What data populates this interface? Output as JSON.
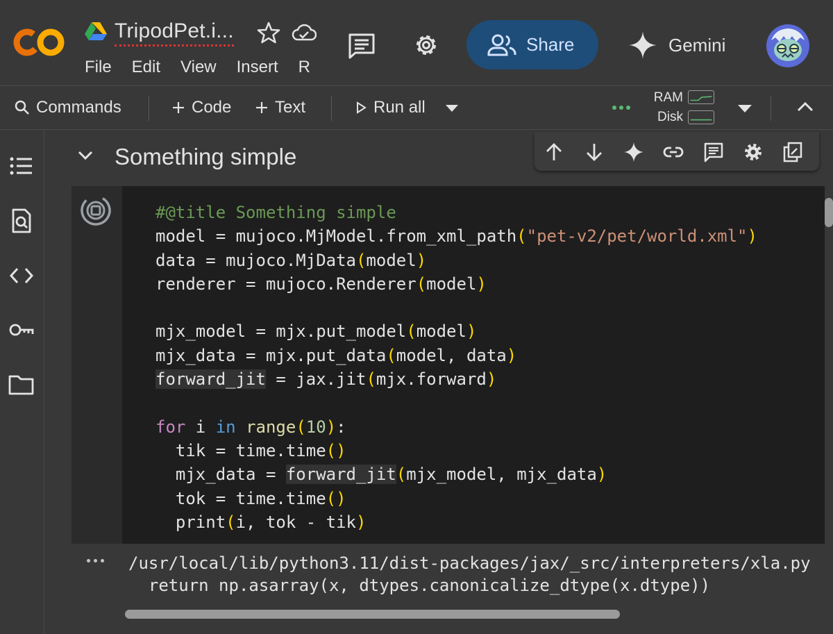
{
  "header": {
    "logo_text": "CO",
    "doc_title": "TripodPet.i...",
    "menu": [
      "File",
      "Edit",
      "View",
      "Insert",
      "R"
    ],
    "share_label": "Share",
    "gemini_label": "Gemini"
  },
  "toolbar": {
    "commands_label": "Commands",
    "code_label": "Code",
    "text_label": "Text",
    "run_all_label": "Run all",
    "ram_label": "RAM",
    "disk_label": "Disk"
  },
  "sidebar": {
    "icons": [
      "table-of-contents-icon",
      "find-replace-icon",
      "code-snippets-icon",
      "secrets-key-icon",
      "files-folder-icon"
    ]
  },
  "section": {
    "title": "Something simple"
  },
  "cell_toolbar": {
    "icons": [
      "move-up-icon",
      "move-down-icon",
      "gemini-sparkle-icon",
      "link-icon",
      "comment-icon",
      "settings-icon",
      "mirror-cell-icon"
    ]
  },
  "code_cell": {
    "lines": [
      "#@title Something simple",
      "model = mujoco.MjModel.from_xml_path(\"pet-v2/pet/world.xml\")",
      "data = mujoco.MjData(model)",
      "renderer = mujoco.Renderer(model)",
      "",
      "mjx_model = mjx.put_model(model)",
      "mjx_data = mjx.put_data(model, data)",
      "forward_jit = jax.jit(mjx.forward)",
      "",
      "for i in range(10):",
      "  tik = time.time()",
      "  mjx_data = forward_jit(mjx_model, mjx_data)",
      "  tok = time.time()",
      "  print(i, tok - tik)"
    ]
  },
  "output": {
    "lines": [
      "/usr/local/lib/python3.11/dist-packages/jax/_src/interpreters/xla.py",
      "  return np.asarray(x, dtypes.canonicalize_dtype(x.dtype))"
    ]
  },
  "colors": {
    "share_bg": "#1e4d7a",
    "logo_orange": "#f9ab00",
    "logo_dark_orange": "#e8710a",
    "status_green": "#5bb974"
  }
}
